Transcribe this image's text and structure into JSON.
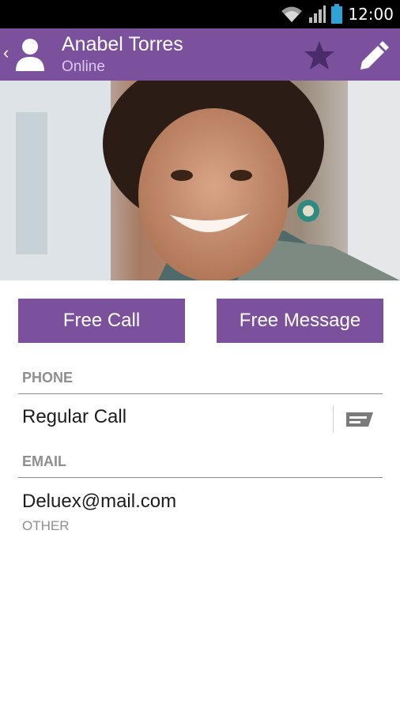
{
  "status_bar": {
    "time": "12:00",
    "icons": [
      "wifi-icon",
      "signal-icon",
      "battery-icon"
    ]
  },
  "header": {
    "name": "Anabel Torres",
    "status": "Online",
    "icons": [
      "back-chevron-icon",
      "contact-avatar-icon",
      "star-icon",
      "pencil-icon"
    ]
  },
  "photo": {
    "subject": "contact-photo"
  },
  "actions": {
    "free_call": "Free Call",
    "free_message": "Free Message"
  },
  "phone_section": {
    "header": "PHONE",
    "row_label": "Regular Call",
    "row_icon": "message-icon"
  },
  "email_section": {
    "header": "EMAIL",
    "address": "Deluex@mail.com",
    "type": "OTHER"
  },
  "colors": {
    "accent": "#7b519d",
    "status_text": "#ddc9f0",
    "section_header": "#8e8e8e"
  }
}
